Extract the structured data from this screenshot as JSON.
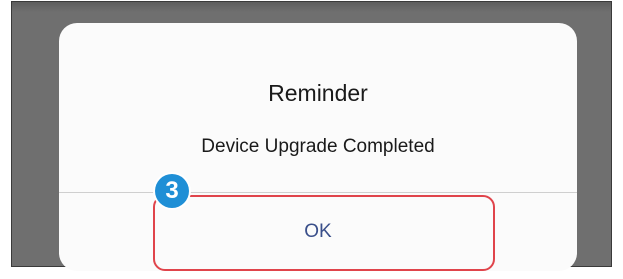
{
  "dialog": {
    "title": "Reminder",
    "message": "Device Upgrade Completed",
    "ok_label": "OK"
  },
  "annotation": {
    "step_number": "3",
    "badge_color": "#1f8fd6",
    "highlight_color": "#e0444b"
  }
}
